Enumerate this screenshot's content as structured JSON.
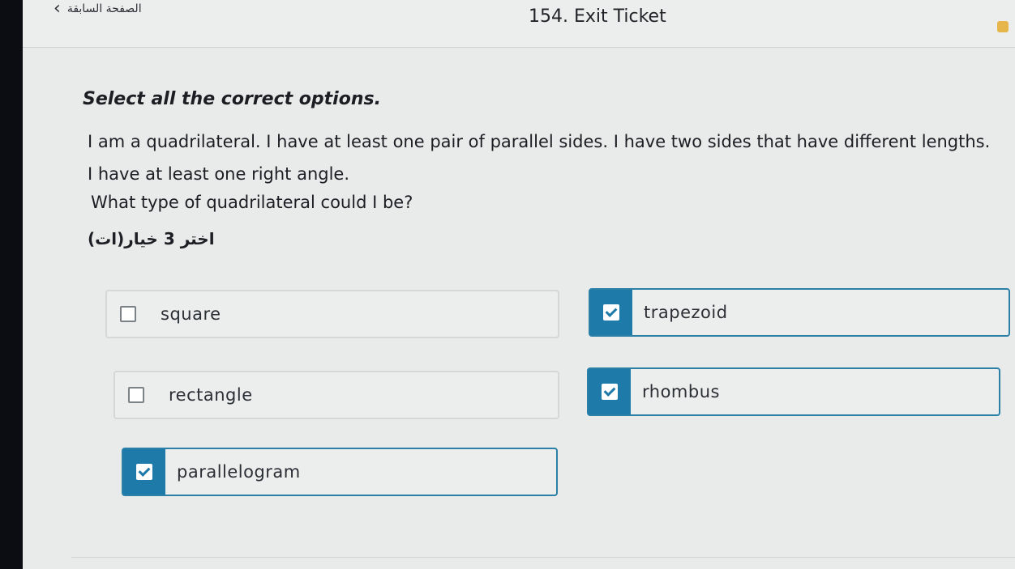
{
  "header": {
    "back_label": "الصفحة السابقة",
    "title": "154. Exit Ticket"
  },
  "question": {
    "heading": "Select all the correct options.",
    "body": "I am a quadrilateral. I have at least one pair of parallel sides. I have two sides that have different lengths. I have at least one right angle.",
    "ask": "What type of quadrilateral could I be?",
    "hint": "اختر 3 خيار(ات)"
  },
  "options": [
    {
      "label": "square",
      "checked": false
    },
    {
      "label": "trapezoid",
      "checked": true
    },
    {
      "label": "rectangle",
      "checked": false
    },
    {
      "label": "rhombus",
      "checked": true
    },
    {
      "label": "parallelogram",
      "checked": true
    }
  ],
  "colors": {
    "accent": "#1e7aa8",
    "badge": "#e7b64b"
  },
  "icons": {
    "back": "chevron-left-icon",
    "checkbox": "checkbox-icon"
  }
}
